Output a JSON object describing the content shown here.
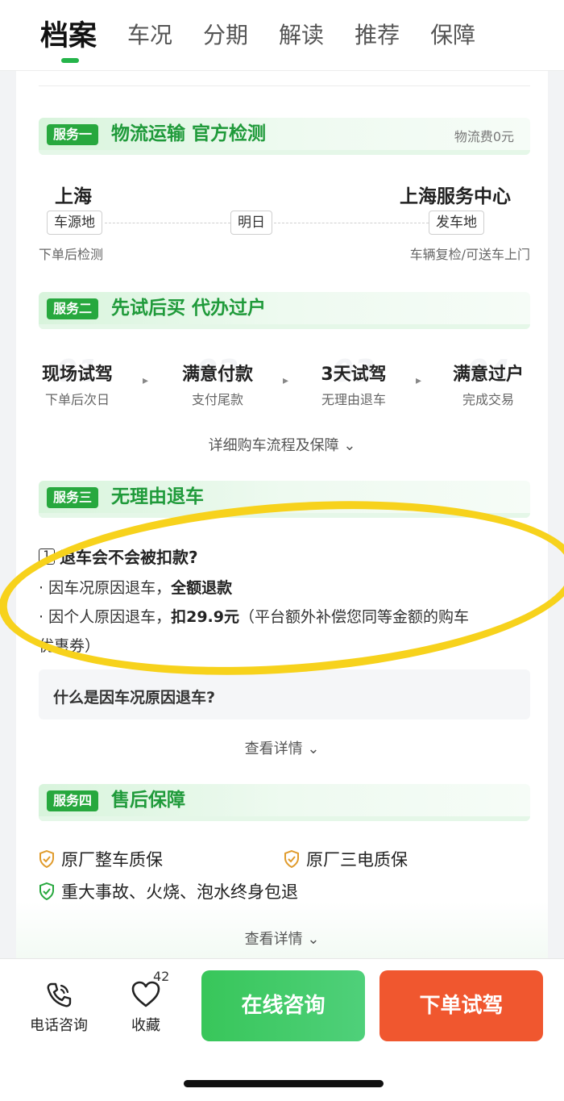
{
  "tabs": [
    {
      "label": "档案"
    },
    {
      "label": "车况"
    },
    {
      "label": "分期"
    },
    {
      "label": "解读"
    },
    {
      "label": "推荐"
    },
    {
      "label": "保障"
    }
  ],
  "service1": {
    "tag": "服务一",
    "title": "物流运输 官方检测",
    "note": "物流费0元",
    "origin_city": "上海",
    "origin_pill": "车源地",
    "eta_pill": "明日",
    "dest_city": "上海服务中心",
    "dest_pill": "发车地",
    "origin_note": "下单后检测",
    "dest_note": "车辆复检/可送车上门"
  },
  "service2": {
    "tag": "服务二",
    "title": "先试后买 代办过户",
    "steps": [
      {
        "num": "01",
        "title": "现场试驾",
        "sub": "下单后次日"
      },
      {
        "num": "02",
        "title": "满意付款",
        "sub": "支付尾款"
      },
      {
        "num": "03",
        "title": "3天试驾",
        "sub": "无理由退车"
      },
      {
        "num": "04",
        "title": "满意过户",
        "sub": "完成交易"
      }
    ],
    "link": "详细购车流程及保障 ⌄"
  },
  "service3": {
    "tag": "服务三",
    "title": "无理由退车",
    "q_num": "1",
    "q_title": "退车会不会被扣款?",
    "line1_a": "· 因车况原因退车，",
    "line1_b": "全额退款",
    "line2_a": "· 因个人原因退车，",
    "line2_b": "扣29.9元",
    "line2_c": "（平台额外补偿您同等金额的购车",
    "line2_d": "优惠券）",
    "faq": "什么是因车况原因退车?",
    "link": "查看详情 ⌄"
  },
  "service4": {
    "tag": "服务四",
    "title": "售后保障",
    "feat1": "原厂整车质保",
    "feat2": "原厂三电质保",
    "feat3": "重大事故、火烧、泡水终身包退",
    "link": "查看详情 ⌄"
  },
  "bottom_bar": {
    "phone_label": "电话咨询",
    "fav_label": "收藏",
    "fav_count": "42",
    "consult_btn": "在线咨询",
    "order_btn": "下单试驾"
  },
  "colors": {
    "accent_green": "#27a83e",
    "highlight_yellow": "#f7d21c",
    "order_red": "#f0572f"
  }
}
